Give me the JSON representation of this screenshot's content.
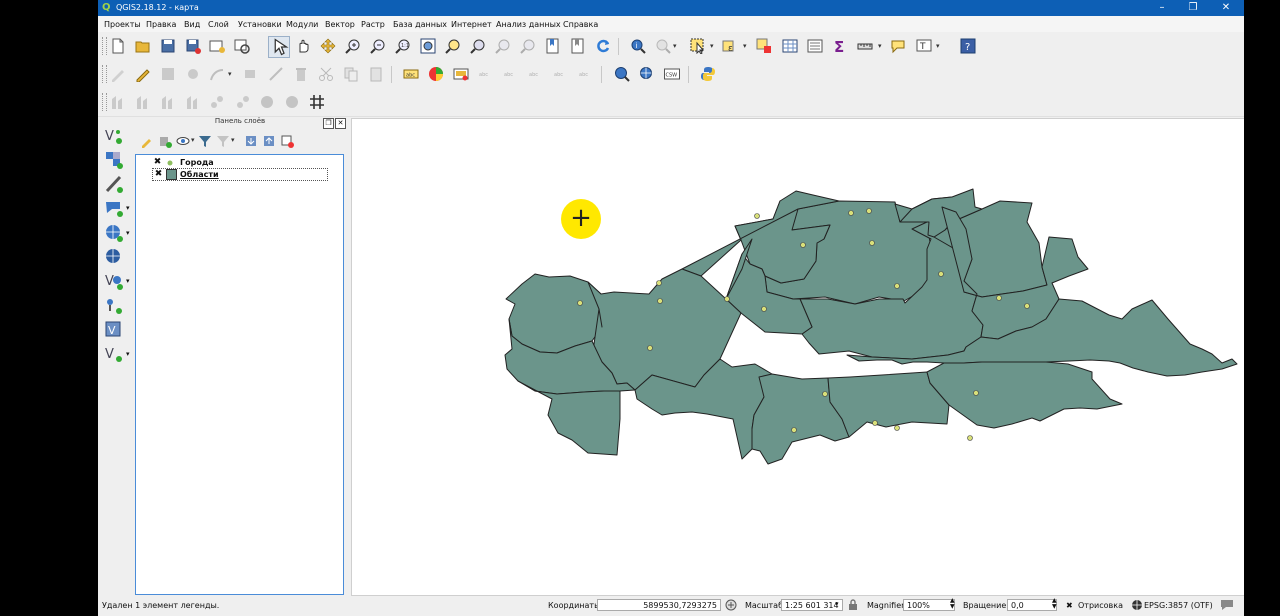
{
  "window": {
    "title": "QGIS2.18.12 - карта",
    "app_icon": "qgis-icon",
    "controls": {
      "minimize": "–",
      "restore": "❐",
      "close": "✕"
    }
  },
  "menu": [
    "Проекты",
    "Правка",
    "Вид",
    "Слой",
    "Установки",
    "Модули",
    "Вектор",
    "Растр",
    "База данных",
    "Интернет",
    "Анализ данных",
    "Справка"
  ],
  "toolbar_icons": {
    "row1": [
      "new-project-icon",
      "open-project-icon",
      "save-project-icon",
      "save-as-icon",
      "new-print-composer-icon",
      "composer-manager-icon",
      "pan-to-selection-icon",
      "pan-icon",
      "pan-map-icon",
      "zoom-in-icon",
      "zoom-out-icon",
      "zoom-native-icon",
      "zoom-full-icon",
      "zoom-to-selection-icon",
      "zoom-to-layer-icon",
      "zoom-last-icon",
      "zoom-next-icon",
      "new-bookmark-icon",
      "show-bookmarks-icon",
      "refresh-icon",
      "identify-icon",
      "measure-icon",
      "select-feature-icon",
      "select-by-expression-icon",
      "deselect-icon",
      "attribute-table-icon",
      "field-calculator-icon",
      "statistics-icon",
      "measure-line-icon",
      "map-tips-icon",
      "text-annotation-icon",
      "help-icon"
    ],
    "row2": [
      "current-edits-icon",
      "toggle-editing-icon",
      "save-edits-icon",
      "digitize-icon",
      "add-feature-icon",
      "move-feature-icon",
      "delete-selected-icon",
      "cut-features-icon",
      "copy-features-icon",
      "paste-features-icon",
      "label-icon",
      "diagram-icon",
      "label-pin-icon",
      "label-show-icon",
      "label-move-icon",
      "label-rotate-icon",
      "label-change-icon",
      "label-undo-icon",
      "metasearch-icon",
      "metasearch-web-icon",
      "csw-icon",
      "python-console-icon"
    ],
    "row3": [
      "add-ring-icon",
      "add-part-icon",
      "fill-ring-icon",
      "delete-ring-icon",
      "delete-part-icon",
      "reshape-icon",
      "offset-curve-icon",
      "split-parts-icon",
      "grid-icon"
    ],
    "csw_label": "CSW"
  },
  "left_toolbar": [
    "add-vector-layer-icon",
    "add-raster-layer-icon",
    "add-delimited-text-icon",
    "add-spatialite-icon",
    "add-wms-icon",
    "add-wcs-icon",
    "add-wfs-icon",
    "add-virtual-layer-icon",
    "new-shapefile-icon"
  ],
  "layers_panel": {
    "title": "Панель слоёв",
    "layers": [
      {
        "name": "Города",
        "checked": "✖",
        "symbol": "point"
      },
      {
        "name": "Области",
        "checked": "✖",
        "symbol": "polygon"
      }
    ]
  },
  "map": {
    "fill_color": "#6b958b",
    "point_color": "#d9e07a"
  },
  "status": {
    "message": "Удален 1 элемент легенды.",
    "coord_label": "Координаты",
    "coordinates": "5899530,7293275",
    "scale_label": "Масштаб",
    "scale": "1:25 601 314",
    "magnifier_label": "Magnifier",
    "magnifier": "100%",
    "rotation_label": "Вращение",
    "rotation": "0,0",
    "render_label": "Отрисовка",
    "render_checked": "✖",
    "crs": "EPSG:3857 (OTF)"
  }
}
